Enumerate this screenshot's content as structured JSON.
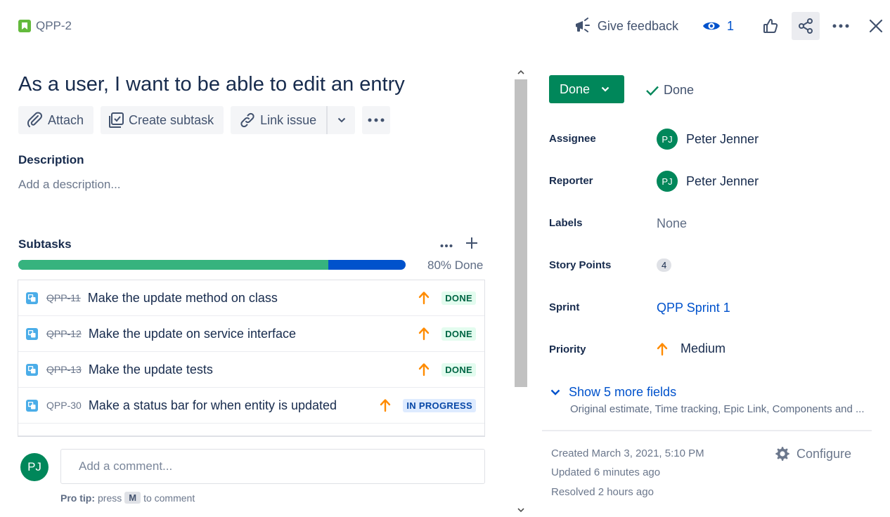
{
  "header": {
    "issue_key": "QPP-2",
    "give_feedback": "Give feedback",
    "watchers_count": "1"
  },
  "issue": {
    "title": "As a user, I want to be able to edit an entry"
  },
  "toolbar": {
    "attach": "Attach",
    "create_subtask": "Create subtask",
    "link_issue": "Link issue"
  },
  "description": {
    "heading": "Description",
    "placeholder": "Add a description..."
  },
  "subtasks": {
    "heading": "Subtasks",
    "progress_fraction": 0.8,
    "progress_label": "80% Done",
    "items": [
      {
        "key": "QPP-11",
        "summary": "Make the update method on class",
        "status": "DONE",
        "resolved": true
      },
      {
        "key": "QPP-12",
        "summary": "Make the update on service interface",
        "status": "DONE",
        "resolved": true
      },
      {
        "key": "QPP-13",
        "summary": "Make the update tests",
        "status": "DONE",
        "resolved": true
      },
      {
        "key": "QPP-30",
        "summary": "Make a status bar for when entity is updated",
        "status": "IN PROGRESS",
        "resolved": false
      }
    ]
  },
  "comment": {
    "avatar_initials": "PJ",
    "placeholder": "Add a comment...",
    "pro_tip_label": "Pro tip:",
    "pro_tip_press": "press",
    "pro_tip_key": "M",
    "pro_tip_suffix": "to comment"
  },
  "status": {
    "button_label": "Done",
    "resolution": "Done"
  },
  "fields": {
    "assignee_label": "Assignee",
    "assignee_initials": "PJ",
    "assignee_name": "Peter Jenner",
    "reporter_label": "Reporter",
    "reporter_initials": "PJ",
    "reporter_name": "Peter Jenner",
    "labels_label": "Labels",
    "labels_value": "None",
    "story_points_label": "Story Points",
    "story_points_value": "4",
    "sprint_label": "Sprint",
    "sprint_value": "QPP Sprint 1",
    "priority_label": "Priority",
    "priority_value": "Medium",
    "show_more": "Show 5 more fields",
    "show_more_subtitle": "Original estimate, Time tracking, Epic Link, Components and ..."
  },
  "meta": {
    "created": "Created March 3, 2021, 5:10 PM",
    "updated": "Updated 6 minutes ago",
    "resolved": "Resolved 2 hours ago",
    "configure": "Configure"
  },
  "colors": {
    "done_green": "#00875a",
    "progress_done": "#36b37e",
    "progress_remaining": "#0052cc",
    "priority_medium": "#ff8b00",
    "link_blue": "#0052cc"
  }
}
